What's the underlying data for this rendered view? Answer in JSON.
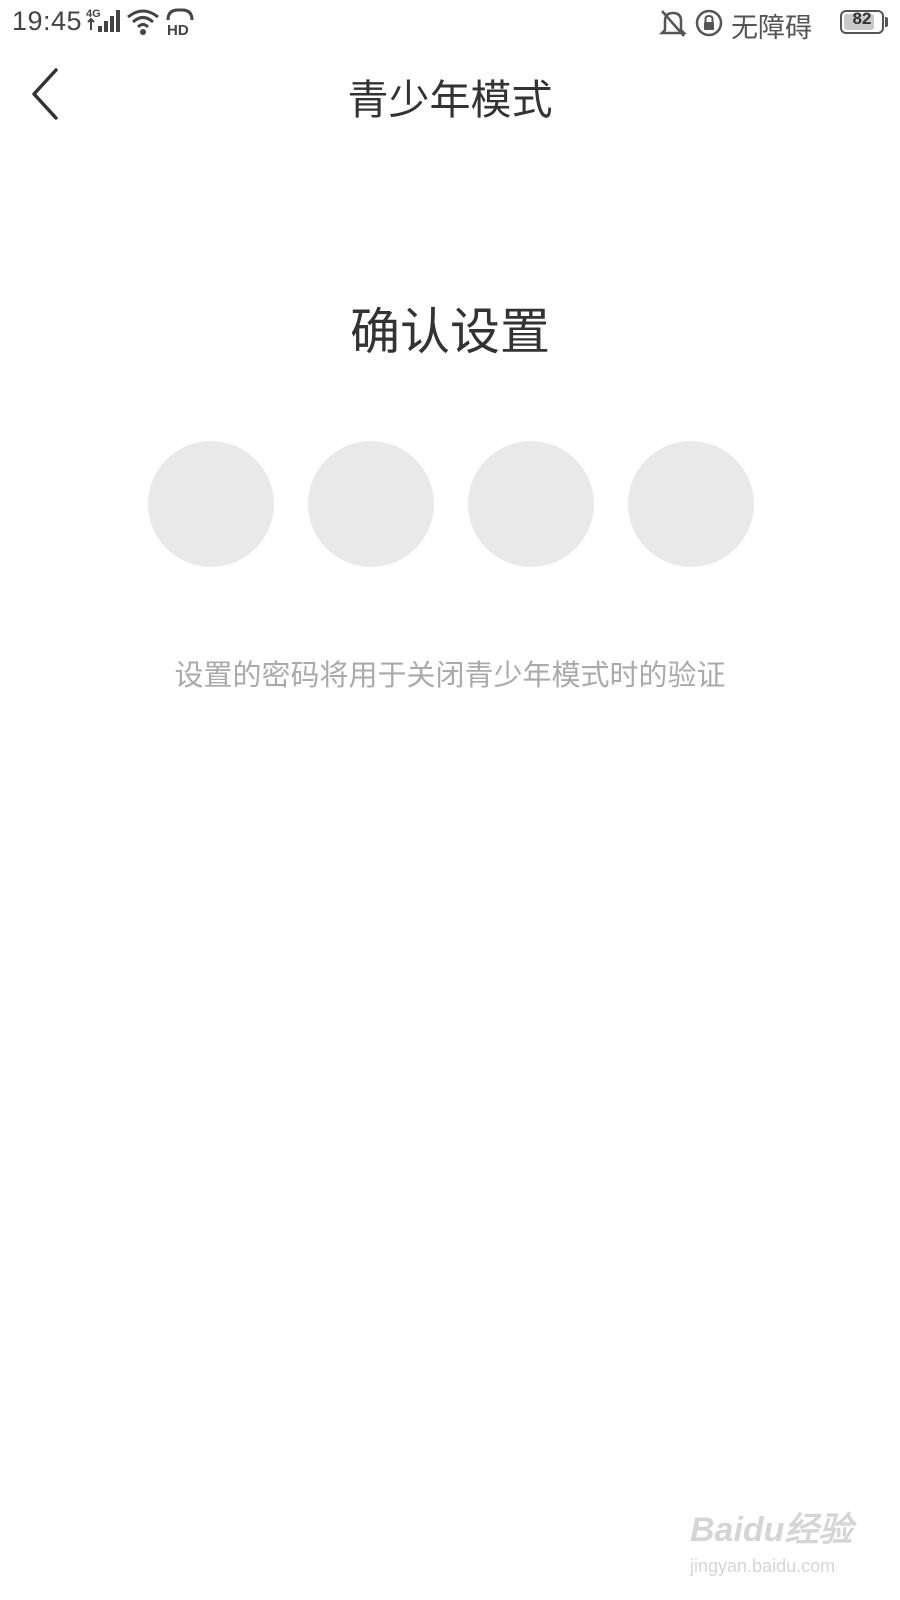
{
  "status_bar": {
    "time": "19:45",
    "network_type": "4G",
    "hd_label": "HD",
    "accessibility_label": "无障碍",
    "battery_level": "82",
    "battery_fraction": 0.82,
    "icons": [
      "signal-icon",
      "wifi-icon",
      "hd-icon",
      "silent-bell-icon",
      "lock-rotation-icon",
      "battery-icon"
    ]
  },
  "nav": {
    "title": "青少年模式",
    "back_icon": "chevron-left-icon"
  },
  "main": {
    "heading": "确认设置",
    "pin_slots": 4,
    "hint": "设置的密码将用于关闭青少年模式时的验证"
  },
  "watermark": {
    "brand": "Baidu经验",
    "url": "jingyan.baidu.com"
  },
  "colors": {
    "background": "#ffffff",
    "title_text": "#333333",
    "hint_text": "#aaaaaa",
    "pin_slot": "#e9e9e9"
  }
}
